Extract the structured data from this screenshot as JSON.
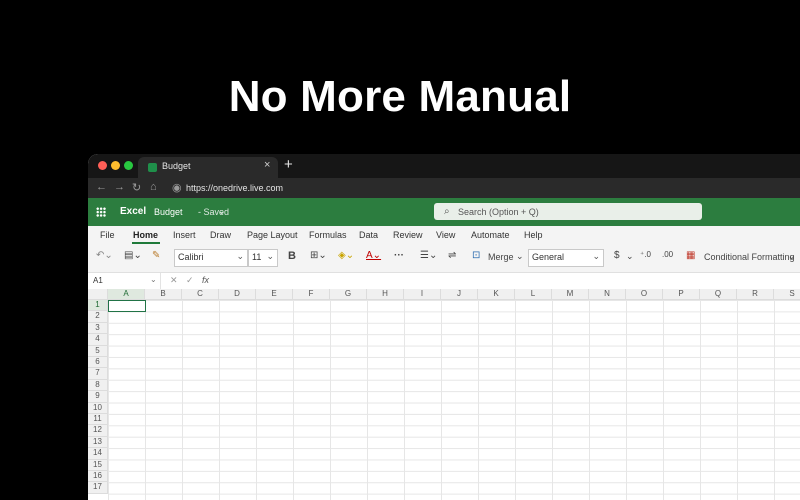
{
  "headline": "No More Manual",
  "browser": {
    "tab_title": "Budget",
    "tab_close": "×",
    "new_tab": "+",
    "url": "https://onedrive.live.com"
  },
  "excel": {
    "app_name": "Excel",
    "doc_name": "Budget",
    "doc_status": "- Saved",
    "search_placeholder": "Search (Option + Q)",
    "brand_color": "#2c7d3f"
  },
  "menu": [
    "File",
    "Home",
    "Insert",
    "Draw",
    "Page Layout",
    "Formulas",
    "Data",
    "Review",
    "View",
    "Automate",
    "Help"
  ],
  "ribbon": {
    "font_name": "Calibri",
    "font_size": "11",
    "bold": "B",
    "merge_label": "Merge",
    "number_format": "General",
    "currency": "$",
    "conditional_formatting": "Conditional Formatting"
  },
  "formula_bar": {
    "name_box": "A1",
    "fx": "fx"
  },
  "grid": {
    "columns": [
      "A",
      "B",
      "C",
      "D",
      "E",
      "F",
      "G",
      "H",
      "I",
      "J",
      "K",
      "L",
      "M",
      "N",
      "O",
      "P",
      "Q",
      "R",
      "S"
    ],
    "rows": [
      "1",
      "2",
      "3",
      "4",
      "5",
      "6",
      "7",
      "8",
      "9",
      "10",
      "11",
      "12",
      "13",
      "14",
      "15",
      "16",
      "17"
    ],
    "selected_cell": "A1"
  }
}
